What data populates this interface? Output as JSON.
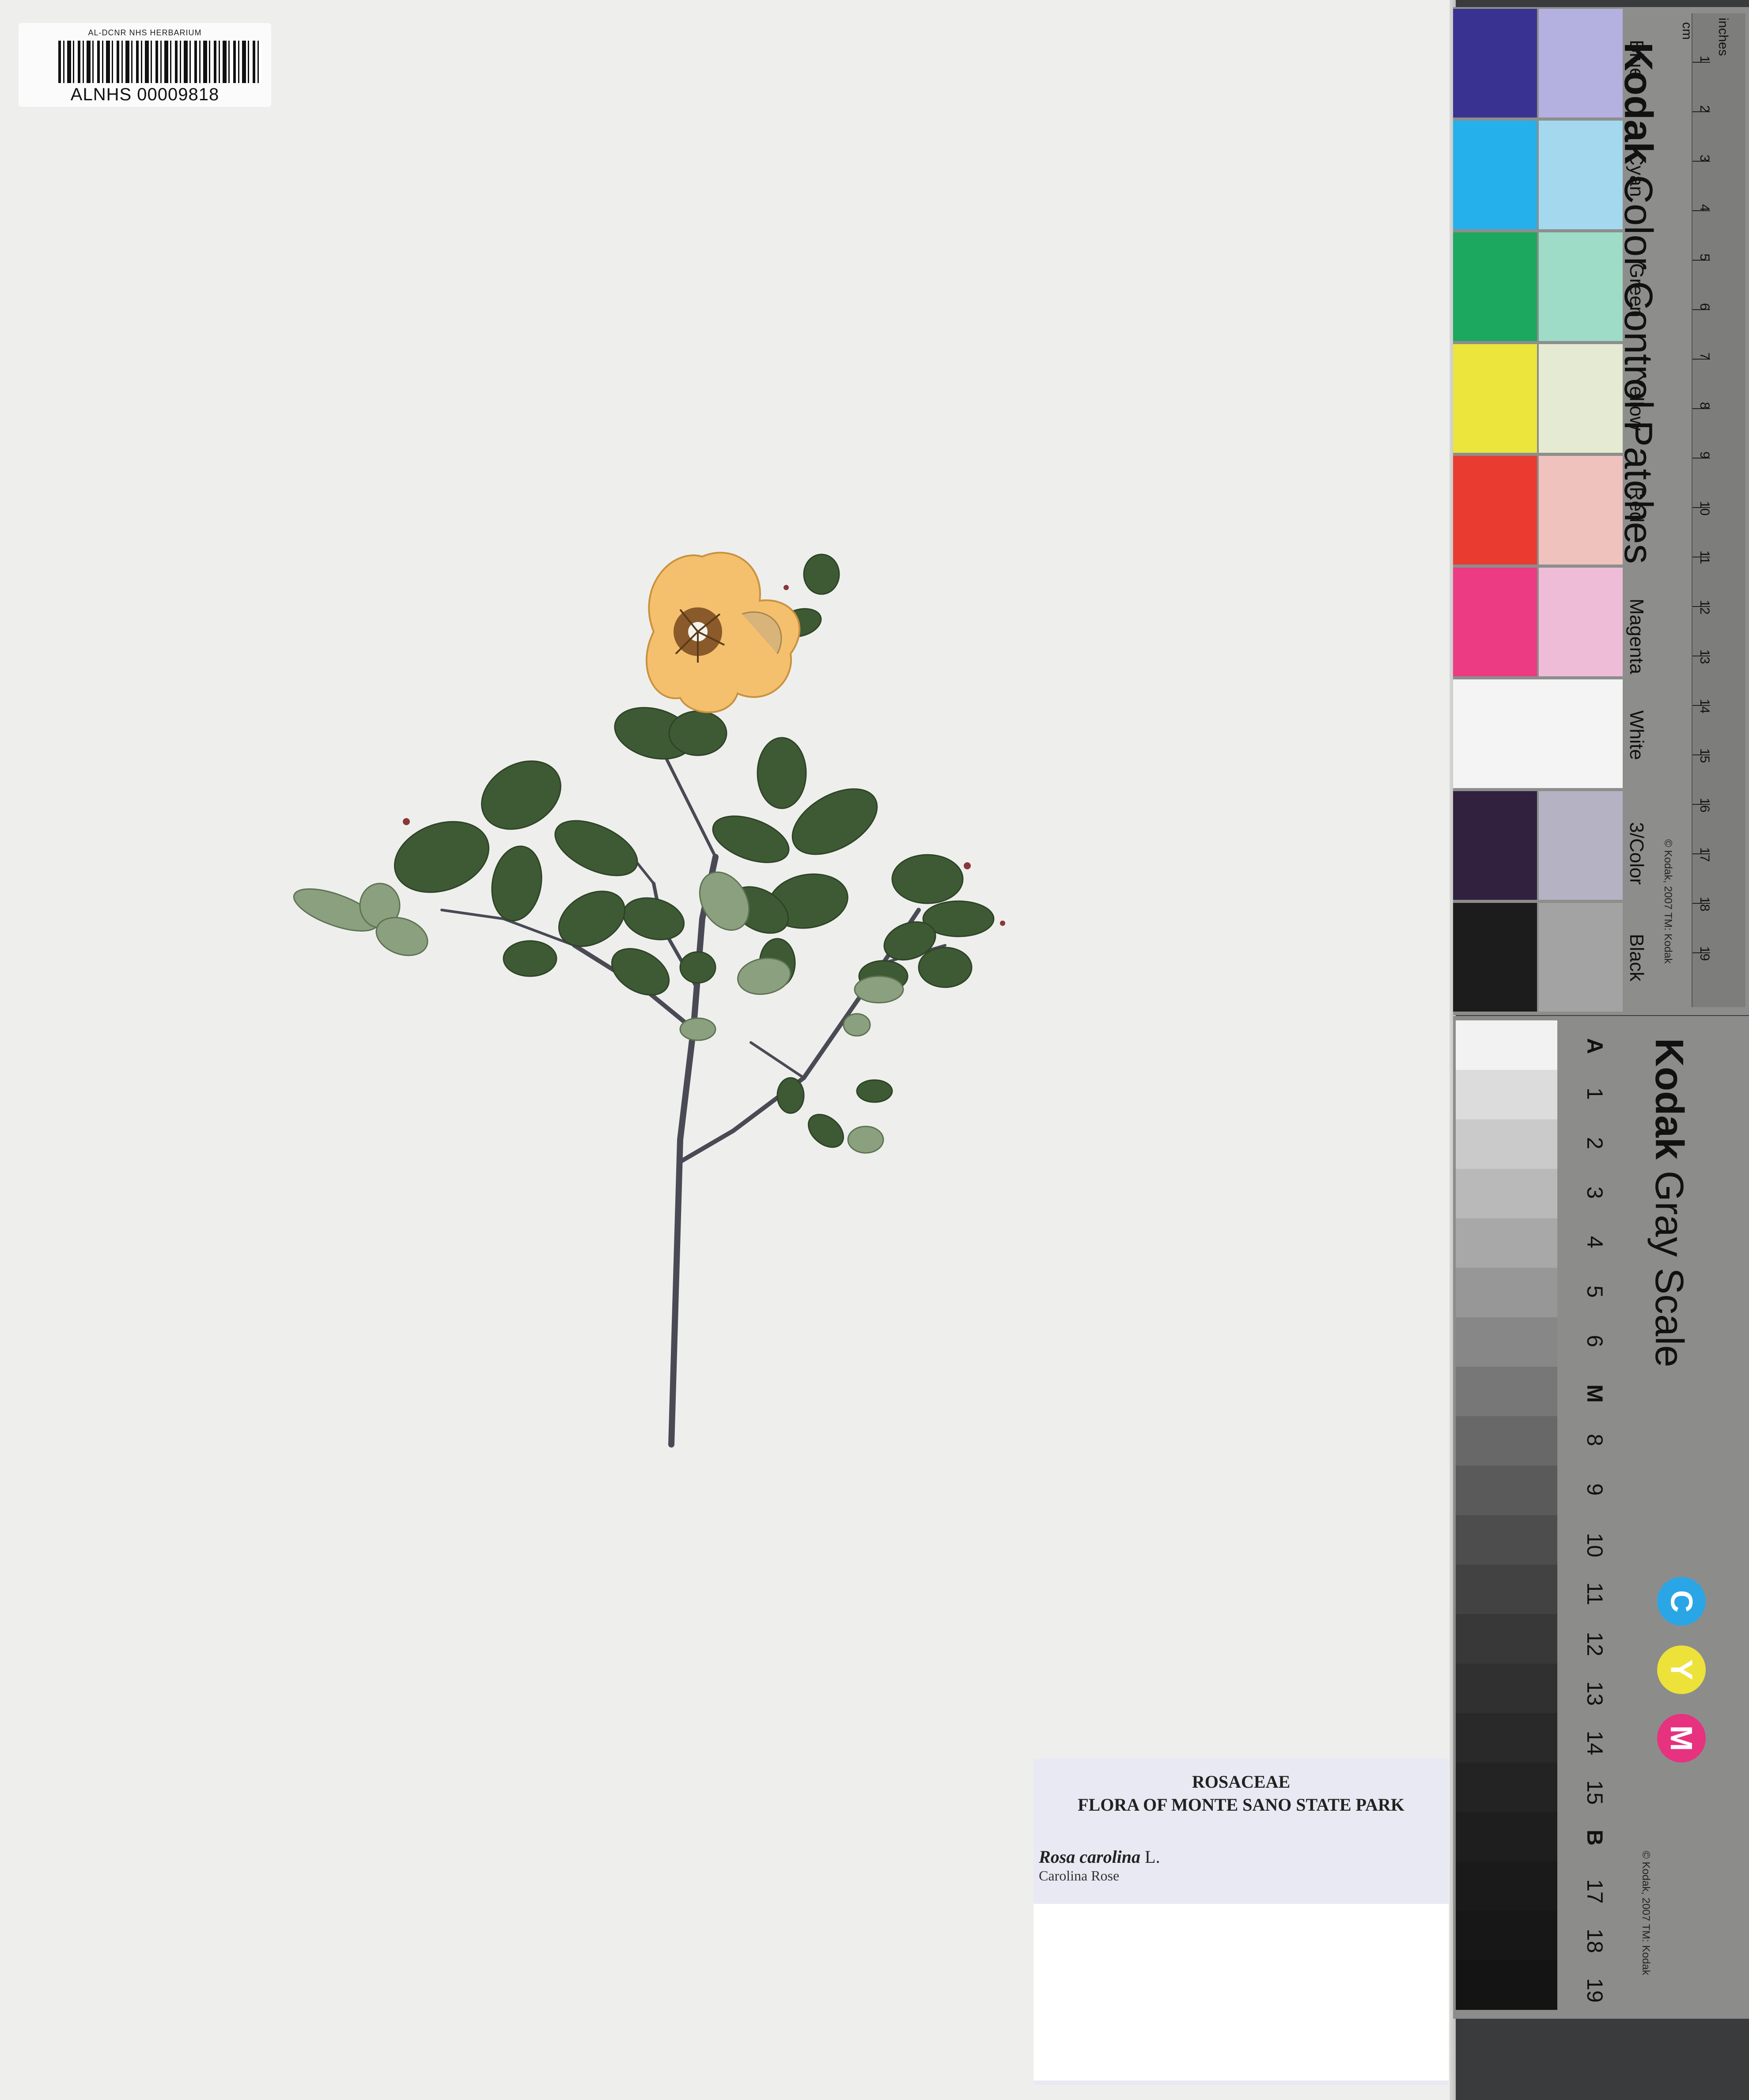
{
  "barcode": {
    "header": "AL-DCNR NHS HERBARIUM",
    "number": "ALNHS 00009818"
  },
  "label": {
    "family": "ROSACEAE",
    "collection": "FLORA OF MONTE SANO STATE PARK",
    "scientific_name": "Rosa carolina",
    "author": "L.",
    "common_name": "Carolina Rose"
  },
  "color_card": {
    "brand": "Kodak",
    "title": "Color Control Patches",
    "patches": [
      {
        "name": "Blue",
        "dark": "#3a3291",
        "light": "#b4b0e0"
      },
      {
        "name": "Cyan",
        "dark": "#25b0ec",
        "light": "#a4d8ef"
      },
      {
        "name": "Green",
        "dark": "#1ca85e",
        "light": "#9edcc8"
      },
      {
        "name": "Yellow",
        "dark": "#ece53c",
        "light": "#e5ead2"
      },
      {
        "name": "Red",
        "dark": "#e93b30",
        "light": "#efc2bd"
      },
      {
        "name": "Magenta",
        "dark": "#ec3a83",
        "light": "#efbcd7"
      },
      {
        "name": "White",
        "dark": "#f4f4f4",
        "light": "#f4f4f4"
      },
      {
        "name": "3/Color",
        "dark": "#31213e",
        "light": "#b4b2c3"
      },
      {
        "name": "Black",
        "dark": "#1c1c1d",
        "light": "#a3a3a3"
      }
    ],
    "copyright": "© Kodak, 2007 TM: Kodak",
    "ruler_cm": [
      "1",
      "2",
      "3",
      "4",
      "5",
      "6",
      "7",
      "8",
      "9",
      "10",
      "11",
      "12",
      "13",
      "14",
      "15",
      "16",
      "17",
      "18",
      "19"
    ],
    "ruler_inches_label": "inches",
    "ruler_cm_label": "cm"
  },
  "gray_card": {
    "brand": "Kodak",
    "title": "Gray Scale",
    "steps": [
      "A",
      "1",
      "2",
      "3",
      "4",
      "5",
      "6",
      "M",
      "8",
      "9",
      "10",
      "11",
      "12",
      "13",
      "14",
      "15",
      "B",
      "17",
      "18",
      "19"
    ],
    "step_colors": [
      "#f2f2f2",
      "#dcdcdc",
      "#cacaca",
      "#b9b9b9",
      "#a8a8a8",
      "#979797",
      "#878787",
      "#777777",
      "#686868",
      "#5a5a5a",
      "#4d4d4d",
      "#424242",
      "#383838",
      "#303030",
      "#292929",
      "#232323",
      "#1e1e1e",
      "#1a1a1a",
      "#171717",
      "#141414"
    ],
    "cmy": [
      {
        "letter": "C",
        "color": "#2aa6e6"
      },
      {
        "letter": "Y",
        "color": "#ede23a"
      },
      {
        "letter": "M",
        "color": "#e6327f"
      }
    ],
    "copyright": "© Kodak, 2007 TM: Kodak"
  }
}
